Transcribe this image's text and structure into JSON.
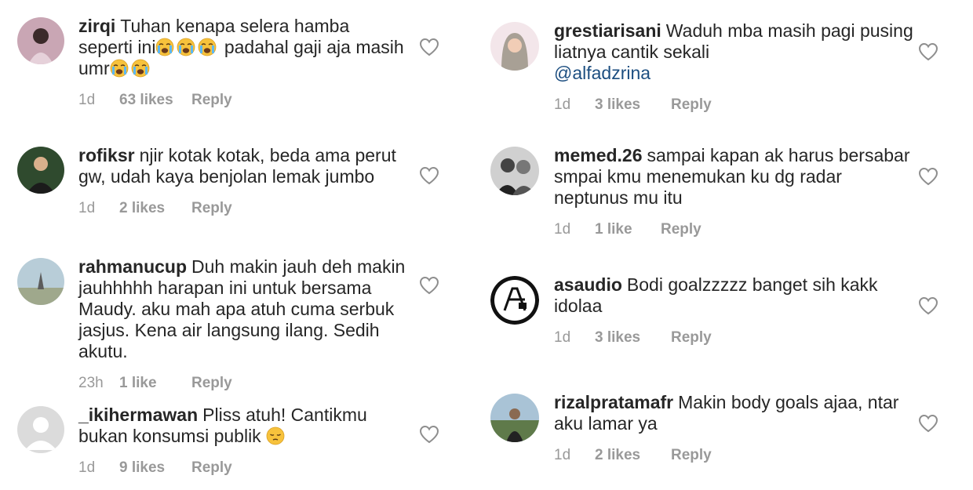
{
  "left": [
    {
      "username": "zirqi",
      "text": "Tuhan kenapa selera hamba seperti ini",
      "text2": " padahal gaji aja masih umr",
      "time": "1d",
      "likes": "63 likes",
      "reply": "Reply"
    },
    {
      "username": "rofiksr",
      "text": "njir kotak kotak, beda ama perut gw, udah kaya benjolan lemak jumbo",
      "time": "1d",
      "likes": "2 likes",
      "reply": "Reply"
    },
    {
      "username": "rahmanucup",
      "text": "Duh makin jauh deh makin jauhhhhh harapan ini untuk bersama Maudy.  aku mah apa atuh cuma serbuk jasjus.  Kena air langsung ilang.  Sedih akutu.",
      "time": "23h",
      "likes": "1 like",
      "reply": "Reply"
    },
    {
      "username": "_ikihermawan",
      "text": "Pliss atuh! Cantikmu bukan konsumsi publik",
      "time": "1d",
      "likes": "9 likes",
      "reply": "Reply"
    }
  ],
  "right": [
    {
      "username": "grestiarisani",
      "text": "Waduh mba masih pagi pusing liatnya cantik sekali",
      "mention": "@alfadzrina",
      "time": "1d",
      "likes": "3 likes",
      "reply": "Reply"
    },
    {
      "username": "memed.26",
      "text": "sampai kapan ak harus bersabar smpai kmu menemukan ku dg radar neptunus mu itu",
      "time": "1d",
      "likes": "1 like",
      "reply": "Reply"
    },
    {
      "username": "asaudio",
      "text": "Bodi goalzzzzz banget sih kakk idolaa",
      "time": "1d",
      "likes": "3 likes",
      "reply": "Reply"
    },
    {
      "username": "rizalpratamafr",
      "text": "Makin body goals ajaa, ntar aku lamar ya",
      "time": "1d",
      "likes": "2 likes",
      "reply": "Reply"
    }
  ],
  "icons": {
    "like": "heart-outline-icon",
    "crying_emoji": "loudly-crying-face-emoji",
    "pensive_emoji": "pensive-face-emoji"
  },
  "colors": {
    "text": "#262626",
    "meta": "#999999",
    "mention": "#1c4e80",
    "heart_outline": "#8e8e8e"
  }
}
